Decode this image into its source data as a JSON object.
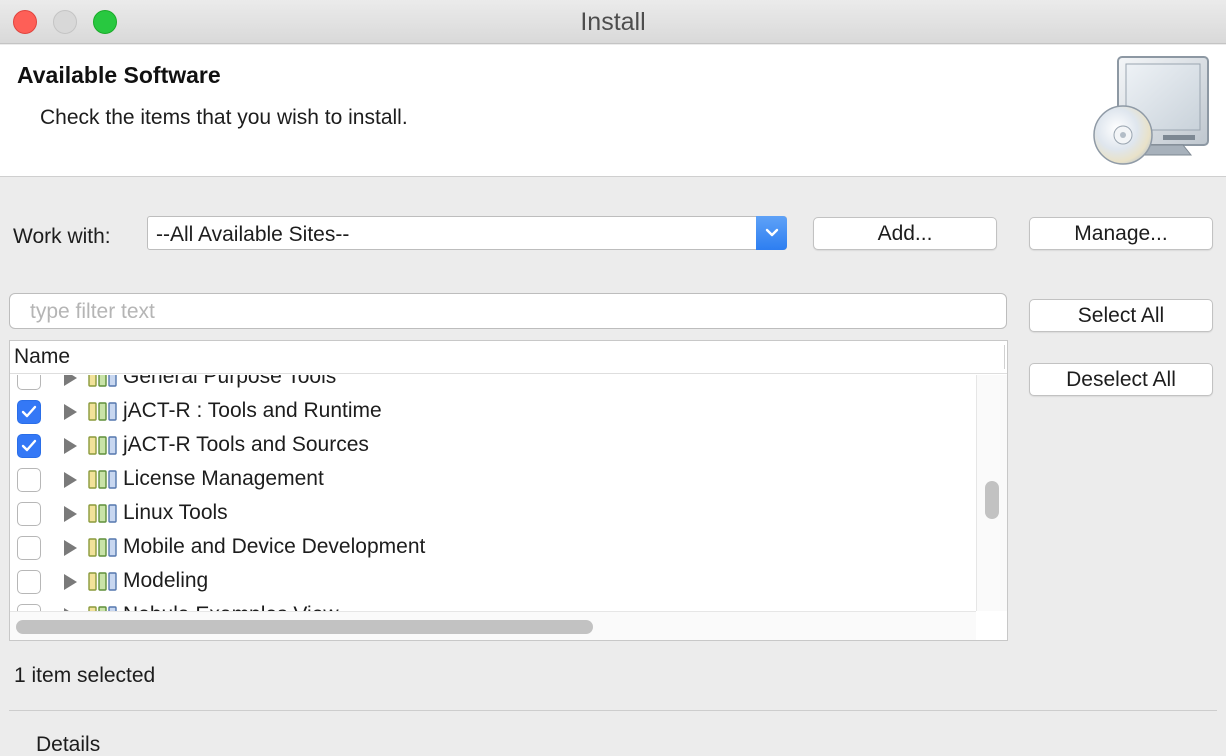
{
  "window": {
    "title": "Install"
  },
  "header": {
    "title": "Available Software",
    "description": "Check the items that you wish to install."
  },
  "work_with": {
    "label": "Work with:",
    "value": "--All Available Sites--",
    "add_label": "Add...",
    "manage_label": "Manage..."
  },
  "filter": {
    "placeholder": "type filter text"
  },
  "buttons": {
    "select_all": "Select All",
    "deselect_all": "Deselect All"
  },
  "tree": {
    "column_header": "Name",
    "rows": [
      {
        "label": "General Purpose Tools",
        "checked": false
      },
      {
        "label": "jACT-R : Tools and Runtime",
        "checked": true
      },
      {
        "label": "jACT-R Tools and Sources",
        "checked": true
      },
      {
        "label": "License Management",
        "checked": false
      },
      {
        "label": "Linux Tools",
        "checked": false
      },
      {
        "label": "Mobile and Device Development",
        "checked": false
      },
      {
        "label": "Modeling",
        "checked": false
      },
      {
        "label": "Nebula Examples View",
        "checked": false
      }
    ]
  },
  "status": {
    "text": "1 item selected"
  },
  "details": {
    "label": "Details"
  },
  "colors": {
    "accent": "#3478f6",
    "close": "#fe5f57",
    "maximize": "#28c840"
  }
}
